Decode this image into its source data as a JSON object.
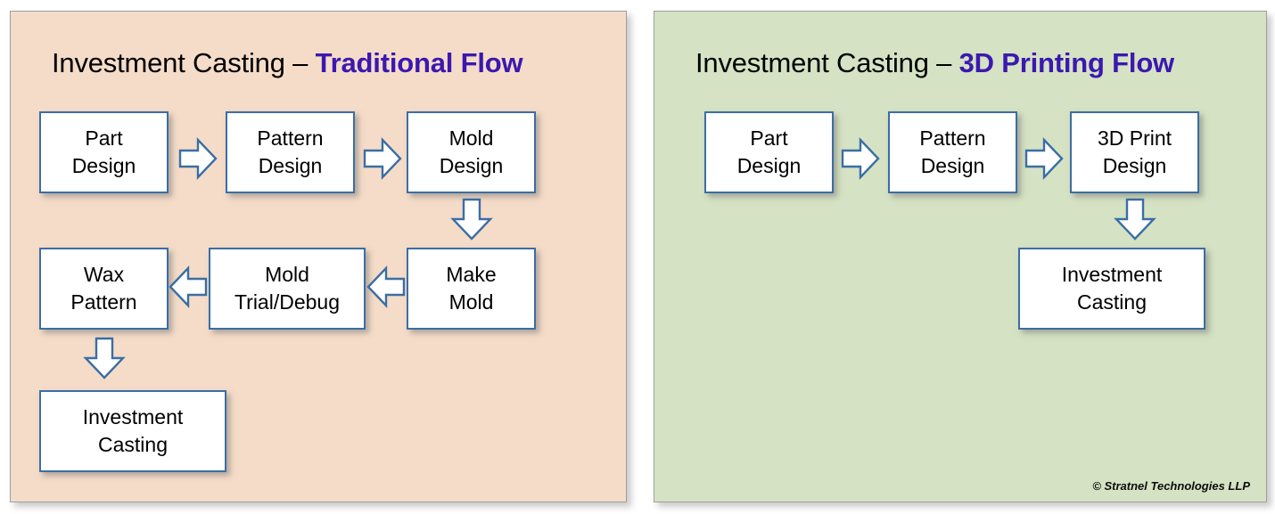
{
  "panels": [
    {
      "id": "traditional",
      "title_prefix": "Investment Casting – ",
      "title_accent": "Traditional Flow",
      "background_color": "#F5DCC8",
      "box_border_color": "#3A6EA5",
      "accent_color": "#3B18B0",
      "boxes": [
        {
          "name": "part-design",
          "line1": "Part",
          "line2": "Design"
        },
        {
          "name": "pattern-design",
          "line1": "Pattern",
          "line2": "Design"
        },
        {
          "name": "mold-design",
          "line1": "Mold",
          "line2": "Design"
        },
        {
          "name": "make-mold",
          "line1": "Make",
          "line2": "Mold"
        },
        {
          "name": "mold-trial-debug",
          "line1": "Mold",
          "line2": "Trial/Debug"
        },
        {
          "name": "wax-pattern",
          "line1": "Wax",
          "line2": "Pattern"
        },
        {
          "name": "investment-casting",
          "line1": "Investment",
          "line2": "Casting"
        }
      ],
      "arrows": [
        {
          "name": "arrow-part-to-pattern",
          "direction": "right"
        },
        {
          "name": "arrow-pattern-to-mold",
          "direction": "right"
        },
        {
          "name": "arrow-mold-design-to-make-mold",
          "direction": "down"
        },
        {
          "name": "arrow-make-mold-to-trial",
          "direction": "left"
        },
        {
          "name": "arrow-trial-to-wax",
          "direction": "left"
        },
        {
          "name": "arrow-wax-to-investment",
          "direction": "down"
        }
      ]
    },
    {
      "id": "3dprinting",
      "title_prefix": "Investment Casting – ",
      "title_accent": "3D Printing Flow",
      "background_color": "#D5E2C3",
      "box_border_color": "#3A6EA5",
      "accent_color": "#3B18B0",
      "boxes": [
        {
          "name": "part-design",
          "line1": "Part",
          "line2": "Design"
        },
        {
          "name": "pattern-design",
          "line1": "Pattern",
          "line2": "Design"
        },
        {
          "name": "3d-print-design",
          "line1": "3D Print",
          "line2": "Design"
        },
        {
          "name": "investment-casting",
          "line1": "Investment",
          "line2": "Casting"
        }
      ],
      "arrows": [
        {
          "name": "arrow-part-to-pattern",
          "direction": "right"
        },
        {
          "name": "arrow-pattern-to-3dprint",
          "direction": "right"
        },
        {
          "name": "arrow-3dprint-to-investment",
          "direction": "down"
        }
      ]
    }
  ],
  "copyright": "© Stratnel Technologies LLP"
}
